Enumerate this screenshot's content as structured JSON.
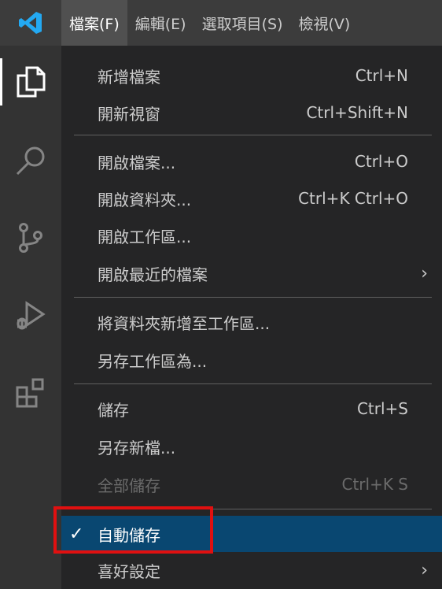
{
  "menubar": {
    "items": [
      "檔案(F)",
      "編輯(E)",
      "選取項目(S)",
      "檢視(V)"
    ]
  },
  "activitybar": {
    "icons": [
      "explorer-icon",
      "search-icon",
      "source-control-icon",
      "run-debug-icon",
      "extensions-icon"
    ]
  },
  "file_menu": {
    "new_file": {
      "label": "新增檔案",
      "shortcut": "Ctrl+N"
    },
    "new_window": {
      "label": "開新視窗",
      "shortcut": "Ctrl+Shift+N"
    },
    "open_file": {
      "label": "開啟檔案...",
      "shortcut": "Ctrl+O"
    },
    "open_folder": {
      "label": "開啟資料夾...",
      "shortcut": "Ctrl+K Ctrl+O"
    },
    "open_workspace": {
      "label": "開啟工作區..."
    },
    "open_recent": {
      "label": "開啟最近的檔案",
      "arrow": "›"
    },
    "add_folder": {
      "label": "將資料夾新增至工作區..."
    },
    "save_workspace_as": {
      "label": "另存工作區為..."
    },
    "save": {
      "label": "儲存",
      "shortcut": "Ctrl+S"
    },
    "save_as": {
      "label": "另存新檔..."
    },
    "save_all": {
      "label": "全部儲存",
      "shortcut": "Ctrl+K S"
    },
    "auto_save": {
      "label": "自動儲存",
      "check": "✓"
    },
    "preferences": {
      "label": "喜好設定",
      "arrow": "›"
    }
  },
  "colors": {
    "accent_blue": "#094771",
    "highlight_red": "#e01010",
    "vscode_logo": "#23a9f2"
  }
}
